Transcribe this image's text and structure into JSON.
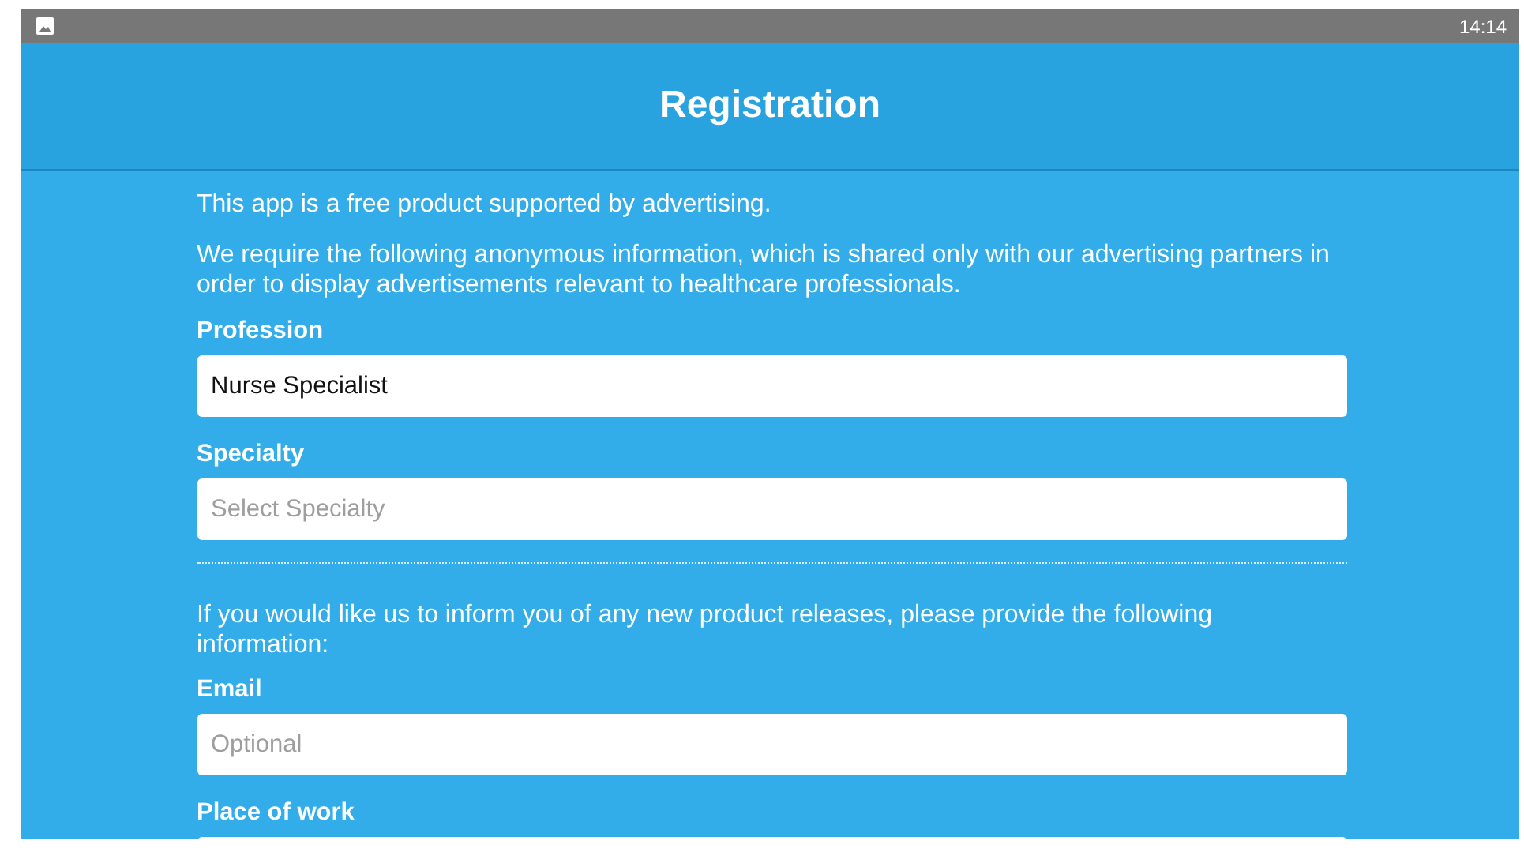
{
  "status_bar": {
    "time": "14:14"
  },
  "header": {
    "title": "Registration"
  },
  "intro": [
    "This app is a free product supported by advertising.",
    "We require the following anonymous information, which is shared only with our advertising partners in order to display advertisements relevant to healthcare professionals."
  ],
  "fields_required": [
    {
      "label": "Profession",
      "value": "Nurse Specialist"
    },
    {
      "label": "Specialty",
      "placeholder": "Select Specialty"
    }
  ],
  "optional_note": "If you would like us to inform you of any new product releases, please provide the following information:",
  "fields_optional": [
    {
      "label": "Email",
      "placeholder": "Optional"
    },
    {
      "label": "Place of work"
    }
  ]
}
